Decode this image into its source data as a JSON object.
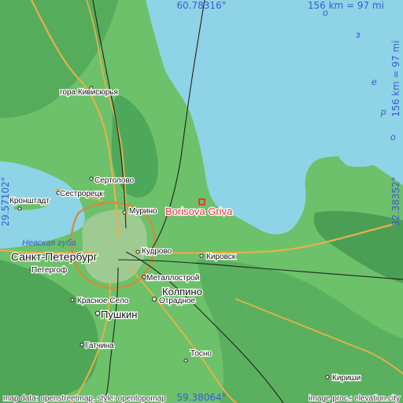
{
  "map": {
    "highlight_place": "Borisova Griva",
    "coords": {
      "north": "60.78316°",
      "south": "59.38064°",
      "west": "29.57102°",
      "east": "32.38352°"
    },
    "scale": {
      "top": "156 km = 97 mi",
      "right": "156 km = 97 mi"
    },
    "attribution": {
      "left": "map data: openstreetmap, style: opentopomap",
      "right": "image proc.: elevation.city"
    },
    "water_labels": {
      "bay": "Невская губа",
      "lake_letters": [
        "о",
        "з",
        "е",
        "р",
        "о"
      ]
    },
    "places": [
      {
        "name": "гора Кивисюрья",
        "size": "small"
      },
      {
        "name": "Сертолово",
        "size": "small"
      },
      {
        "name": "Кронштадт",
        "size": "small"
      },
      {
        "name": "Сестрорецк",
        "size": "small"
      },
      {
        "name": "Мурино",
        "size": "small"
      },
      {
        "name": "Санкт-Петербург",
        "size": "large"
      },
      {
        "name": "Петергоф",
        "size": "small"
      },
      {
        "name": "Кудрово",
        "size": "small"
      },
      {
        "name": "Кировск",
        "size": "small"
      },
      {
        "name": "Металлострой",
        "size": "small"
      },
      {
        "name": "Колпино",
        "size": "medium"
      },
      {
        "name": "Отрадное",
        "size": "small"
      },
      {
        "name": "Красное Село",
        "size": "small"
      },
      {
        "name": "Пушкин",
        "size": "medium"
      },
      {
        "name": "Гатчина",
        "size": "small"
      },
      {
        "name": "Тосно",
        "size": "small"
      },
      {
        "name": "Кириши",
        "size": "small"
      }
    ],
    "colors": {
      "water": "#8fd3e6",
      "lowland": "#6cc16a",
      "forest": "#4ea85a",
      "upland": "#3f9a4e",
      "highlight": "#e8313a",
      "coord_text": "#3b5bd6"
    }
  }
}
